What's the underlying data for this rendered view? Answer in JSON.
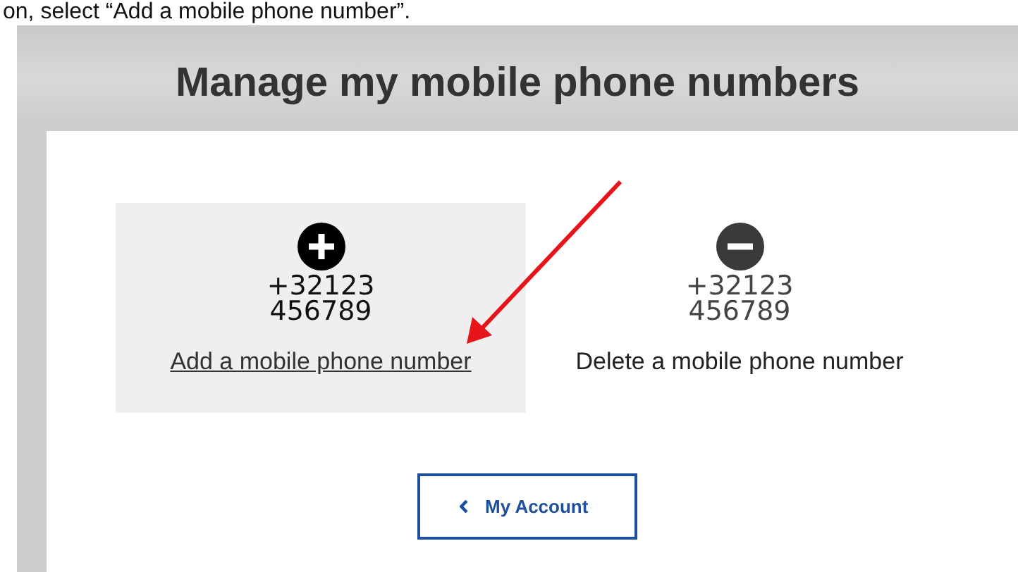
{
  "instruction": "on, select “Add a mobile phone number”.",
  "panel": {
    "title": "Manage my mobile phone numbers"
  },
  "options": [
    {
      "kind": "add",
      "number": "+32123\n456789",
      "label": "Add a mobile phone number",
      "selected": true
    },
    {
      "kind": "delete",
      "number": "+32123\n456789",
      "label": "Delete a mobile phone number",
      "selected": false
    }
  ],
  "back_button": {
    "label": "My Account"
  },
  "annotation": {
    "kind": "arrow",
    "color": "#e8141b"
  }
}
